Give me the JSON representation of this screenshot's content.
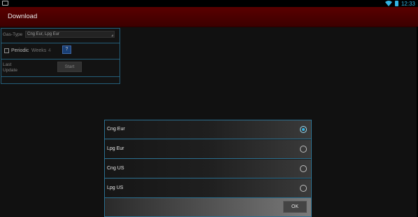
{
  "status_bar": {
    "time": "12:33",
    "accent": "#33b5e5"
  },
  "action_bar": {
    "title": "Download",
    "color": "#4a0000"
  },
  "form": {
    "gas_type_label": "Gas-Type",
    "gas_type_value": "Cng Eur, Lpg Eur",
    "periodic_label": "Periodic",
    "weeks_label": "Weeks",
    "weeks_value": "4",
    "help_label": "?",
    "last_update_label": "Last\nUpdate",
    "start_label": "Start"
  },
  "dialog": {
    "options": [
      {
        "label": "Cng Eur",
        "selected": true
      },
      {
        "label": "Lpg Eur",
        "selected": false
      },
      {
        "label": "Cng US",
        "selected": false
      },
      {
        "label": "Lpg US",
        "selected": false
      }
    ],
    "ok_label": "OK"
  }
}
